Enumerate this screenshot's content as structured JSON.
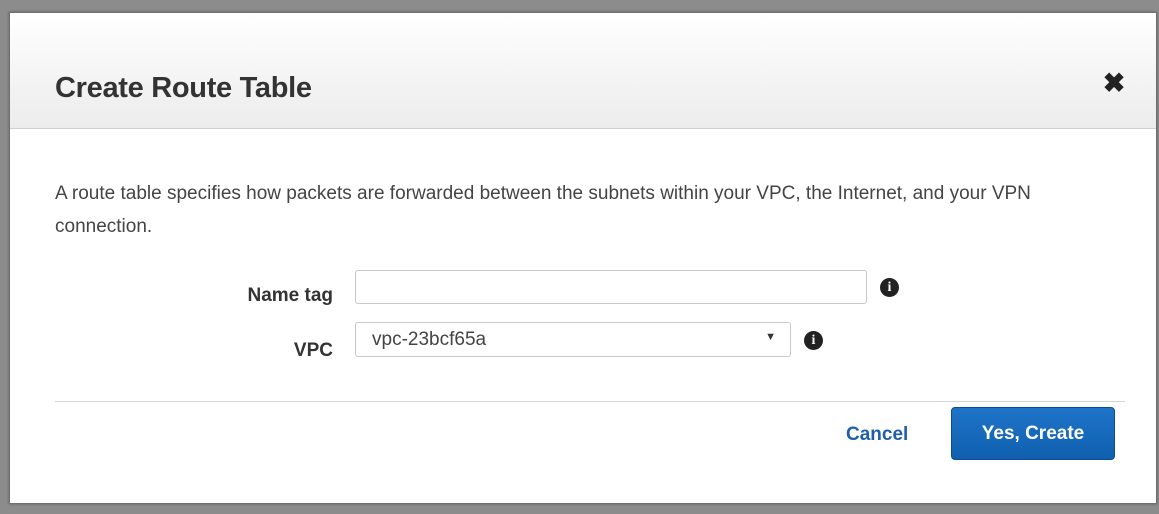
{
  "dialog": {
    "title": "Create Route Table",
    "close_icon": "close-icon"
  },
  "description": "A route table specifies how packets are forwarded between the subnets within your VPC, the Internet, and your VPN connection.",
  "form": {
    "name_tag": {
      "label": "Name tag",
      "value": "",
      "placeholder": ""
    },
    "vpc": {
      "label": "VPC",
      "selected": "vpc-23bcf65a"
    },
    "info_icon_glyph": "i"
  },
  "footer": {
    "cancel_label": "Cancel",
    "create_label": "Yes, Create"
  },
  "colors": {
    "primary_button": "#1566bc",
    "link": "#1f5fa8"
  }
}
